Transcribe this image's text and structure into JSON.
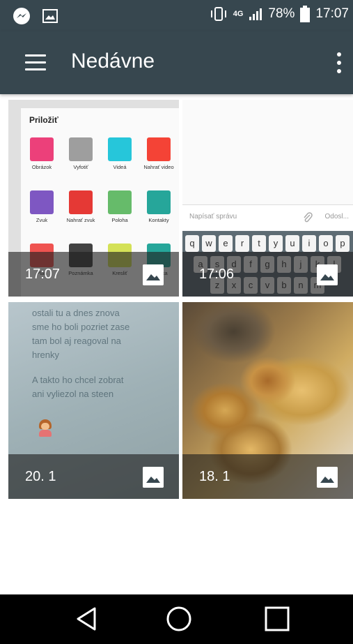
{
  "status_bar": {
    "network": "4G",
    "battery": "78%",
    "time": "17:07"
  },
  "app_bar": {
    "title": "Nedávne"
  },
  "tiles": [
    {
      "label": "17:07",
      "attach_sheet": {
        "title": "Priložiť",
        "items": [
          {
            "label": "Obrázok",
            "icon": "gallery-icon",
            "color": "#ec407a"
          },
          {
            "label": "Vyfotiť",
            "icon": "camera-icon",
            "color": "#9e9e9e"
          },
          {
            "label": "Videá",
            "icon": "video-play-icon",
            "color": "#26c6da"
          },
          {
            "label": "Nahrať video",
            "icon": "record-video-icon",
            "color": "#f44336"
          },
          {
            "label": "Zvuk",
            "icon": "music-icon",
            "color": "#7e57c2"
          },
          {
            "label": "Nahrať zvuk",
            "icon": "microphone-icon",
            "color": "#e53935"
          },
          {
            "label": "Poloha",
            "icon": "map-pin-icon",
            "color": "#66bb6a"
          },
          {
            "label": "Kontakty",
            "icon": "contact-icon",
            "color": "#26a69a"
          },
          {
            "label": "Plán",
            "icon": "calendar-icon",
            "color": "#ef5350"
          },
          {
            "label": "Poznámka",
            "icon": "pencil-icon",
            "color": "#424242"
          },
          {
            "label": "Kresliť",
            "icon": "draw-icon",
            "color": "#d4e157"
          },
          {
            "label": "Snímka",
            "icon": "slide-icon",
            "color": "#26a69a"
          }
        ]
      }
    },
    {
      "label": "17:06",
      "message_placeholder": "Napísať správu",
      "send_label": "Odosl...",
      "keyboard_rows": [
        [
          "q",
          "w",
          "e",
          "r",
          "t",
          "y",
          "u",
          "i",
          "o",
          "p"
        ],
        [
          "a",
          "s",
          "d",
          "f",
          "g",
          "h",
          "j",
          "k",
          "l"
        ],
        [
          "z",
          "x",
          "c",
          "v",
          "b",
          "n",
          "m"
        ]
      ]
    },
    {
      "label": "20. 1",
      "paper_lines": [
        "ostali tu a dnes znova",
        "sme ho boli pozriet zase",
        "tam bol aj reagoval na",
        "hrenky",
        "A takto ho chcel zobrat",
        "ani vyliezol na steen"
      ]
    },
    {
      "label": "18. 1"
    }
  ],
  "nav": {
    "back": "back-icon",
    "home": "home-icon",
    "recents": "recents-icon"
  }
}
